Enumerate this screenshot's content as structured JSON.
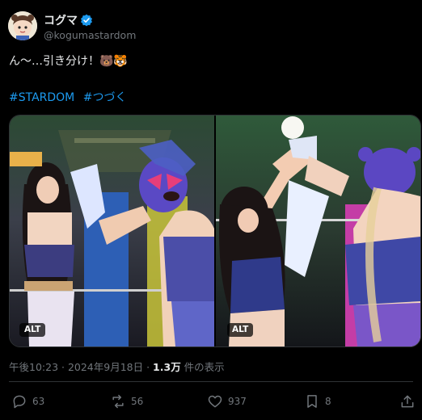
{
  "author": {
    "display_name": "コグマ",
    "handle": "@kogumastardom",
    "verified_icon": "verified-badge-icon"
  },
  "post": {
    "text": "ん〜…引き分け！🐻🐯",
    "hashtags": [
      "#STARDOM",
      "#つづく"
    ]
  },
  "media": {
    "alt_labels": [
      "ALT",
      "ALT"
    ]
  },
  "meta": {
    "time_date": "午後10:23 · 2024年9月18日 · ",
    "views_count": "1.3万",
    "views_suffix": " 件の表示"
  },
  "actions": {
    "reply_count": "63",
    "repost_count": "56",
    "like_count": "937",
    "bookmark_count": "8",
    "icons": [
      "reply-icon",
      "repost-icon",
      "like-icon",
      "bookmark-icon",
      "share-icon"
    ]
  },
  "colors": {
    "background": "#000000",
    "text": "#e7e9ea",
    "muted": "#71767b",
    "link": "#1d9bf0",
    "verified": "#1d9bf0",
    "divider": "#2f3336"
  }
}
